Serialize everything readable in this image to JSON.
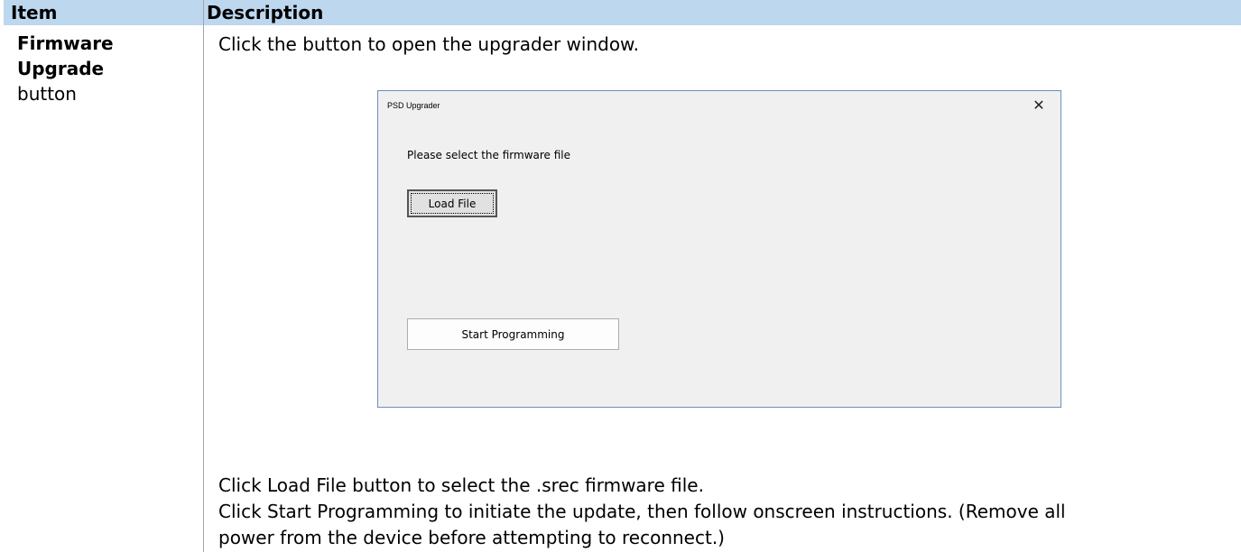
{
  "table": {
    "header_item": "Item",
    "header_description": "Description"
  },
  "row": {
    "item_bold": "Firmware Upgrade",
    "item_plain": "button",
    "intro": "Click the button to open the upgrader window.",
    "notes": [
      "Click Load File button to select the .srec firmware file.",
      "Click Start Programming to initiate the update, then follow onscreen instructions. (Remove all",
      "power from the device before attempting to reconnect.)"
    ]
  },
  "dialog": {
    "title": "PSD Upgrader",
    "close_glyph": "✕",
    "prompt": "Please select the firmware file",
    "load_button": "Load File",
    "start_button": "Start Programming"
  },
  "colors": {
    "header_bg": "#bdd7ee",
    "dialog_bg": "#f0f0f0",
    "dialog_border": "#6c8ebf"
  }
}
